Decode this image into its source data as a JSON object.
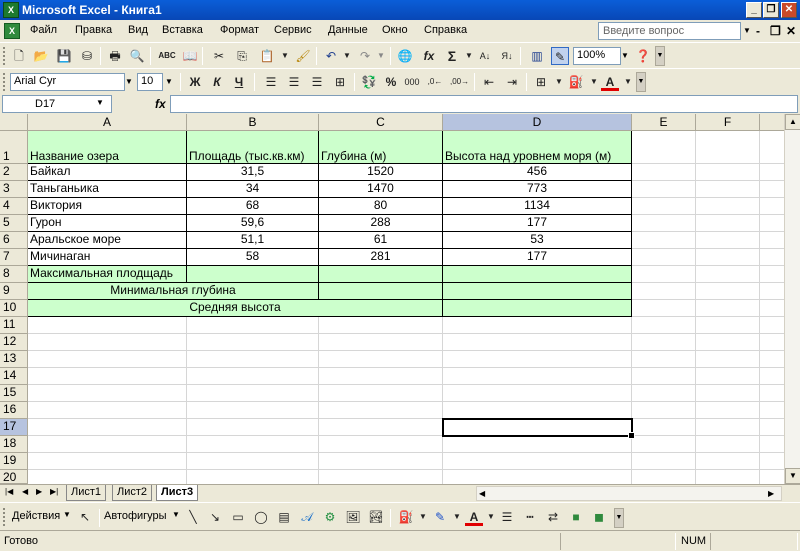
{
  "window": {
    "title": "Microsoft Excel - Книга1",
    "icon_label": "X",
    "controls": {
      "minimize": "_",
      "restore": "❐",
      "close": "✕"
    }
  },
  "menu": {
    "items": [
      "Файл",
      "Правка",
      "Вид",
      "Вставка",
      "Формат",
      "Сервис",
      "Данные",
      "Окно",
      "Справка"
    ],
    "help_placeholder": "Введите вопрос",
    "doc_controls": {
      "minimize": "-",
      "restore": "❐",
      "close": "✕"
    }
  },
  "standard_toolbar": {
    "zoom": "100%"
  },
  "formatting_toolbar": {
    "font": "Arial Cyr",
    "size": "10",
    "bold": "Ж",
    "italic": "К",
    "underline": "Ч",
    "percent": "%",
    "thousands": "000",
    "font_color_letter": "A"
  },
  "formula_bar": {
    "cell_ref": "D17",
    "fx": "fx",
    "value": ""
  },
  "sheet": {
    "columns": [
      "A",
      "B",
      "C",
      "D",
      "E",
      "F"
    ],
    "rows": [
      "1",
      "2",
      "3",
      "4",
      "5",
      "6",
      "7",
      "8",
      "9",
      "10",
      "11",
      "12",
      "13",
      "14",
      "15",
      "16",
      "17",
      "18",
      "19",
      "20"
    ],
    "header": [
      "Название озера",
      "Площадь (тыс.кв.км)",
      "Глубина (м)",
      "Высота над уровнем моря (м)"
    ],
    "data": [
      [
        "Байкал",
        "31,5",
        "1520",
        "456"
      ],
      [
        "Таньганьика",
        "34",
        "1470",
        "773"
      ],
      [
        "Виктория",
        "68",
        "80",
        "1134"
      ],
      [
        "Гурон",
        "59,6",
        "288",
        "177"
      ],
      [
        "Аральское море",
        "51,1",
        "61",
        "53"
      ],
      [
        "Мичинаган",
        "58",
        "281",
        "177"
      ]
    ],
    "summary": {
      "max_area": "Максимальная плодщадь",
      "min_depth": "Минимальная глубина",
      "avg_height": "Средняя высота"
    },
    "highlight_color": "#ccffcc"
  },
  "tabs": [
    "Лист1",
    "Лист2",
    "Лист3"
  ],
  "active_tab": "Лист3",
  "drawing_toolbar": {
    "actions": "Действия",
    "autoshapes": "Автофигуры",
    "font_color_letter": "A"
  },
  "status": {
    "text": "Готово",
    "num": "NUM"
  }
}
